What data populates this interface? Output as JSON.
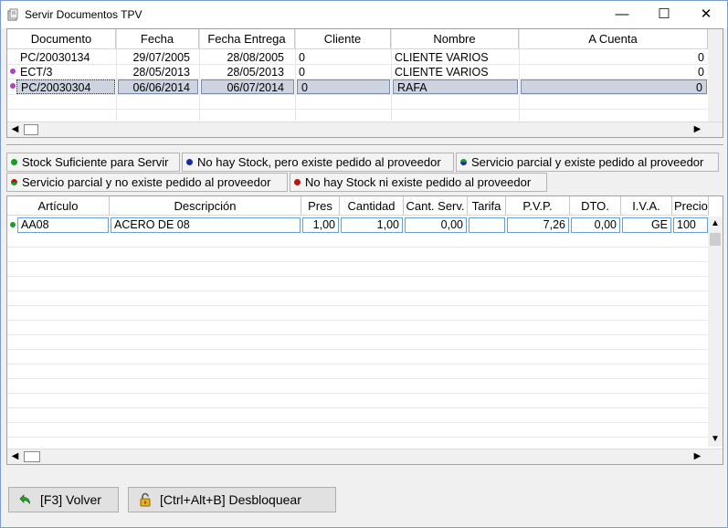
{
  "window": {
    "title": "Servir Documentos TPV",
    "minimize": "—",
    "maximize": "☐",
    "close": "✕"
  },
  "documents": {
    "headers": [
      "Documento",
      "Fecha",
      "Fecha Entrega",
      "Cliente",
      "Nombre",
      "A Cuenta"
    ],
    "rows": [
      {
        "documento": "PC/20030134",
        "fecha": "29/07/2005",
        "entrega": "28/08/2005",
        "cliente": "0",
        "nombre": "CLIENTE VARIOS",
        "cuenta": "0",
        "dot": ""
      },
      {
        "documento": "ECT/3",
        "fecha": "28/05/2013",
        "entrega": "28/05/2013",
        "cliente": "0",
        "nombre": "CLIENTE VARIOS",
        "cuenta": "0",
        "dot": "#b040c0"
      },
      {
        "documento": "PC/20030304",
        "fecha": "06/06/2014",
        "entrega": "06/07/2014",
        "cliente": "0",
        "nombre": "RAFA",
        "cuenta": "0",
        "dot": "#b040c0"
      }
    ]
  },
  "legend": {
    "stock_ok": "Stock Suficiente para Servir",
    "no_stock_pedido": "No hay Stock, pero existe pedido al proveedor",
    "parcial_pedido": "Servicio parcial y existe pedido al proveedor",
    "parcial_no_pedido": "Servicio parcial y no existe pedido al proveedor",
    "no_stock_no_pedido": "No hay Stock ni existe pedido al proveedor",
    "colors": {
      "green": "#1a9a2a",
      "blue": "#1a2aa0",
      "red": "#b01818"
    }
  },
  "lines": {
    "headers": [
      "Artículo",
      "Descripción",
      "Pres",
      "Cantidad",
      "Cant. Serv.",
      "Tarifa",
      "P.V.P.",
      "DTO.",
      "I.V.A.",
      "Precio"
    ],
    "row": {
      "articulo": "AA08",
      "descripcion": "ACERO DE 08",
      "pres": "1,00",
      "cantidad": "1,00",
      "cant_serv": "0,00",
      "tarifa": "",
      "pvp": "7,26",
      "dto": "0,00",
      "iva": "GE",
      "precio": "100"
    }
  },
  "buttons": {
    "volver": "[F3] Volver",
    "desbloquear": "[Ctrl+Alt+B] Desbloquear"
  }
}
